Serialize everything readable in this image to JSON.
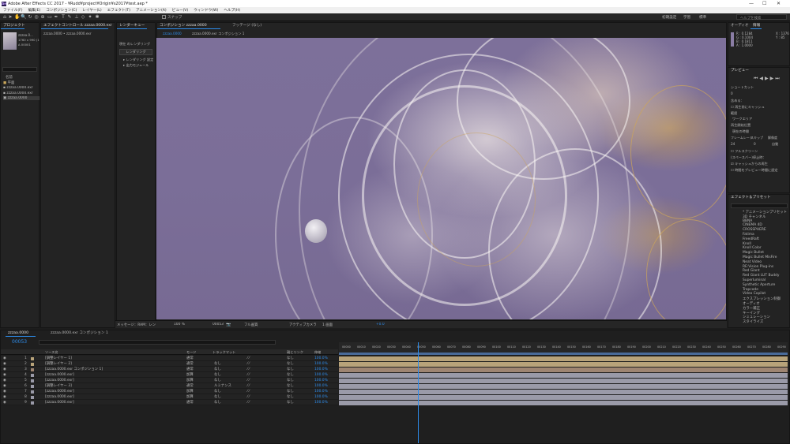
{
  "app": {
    "title": "Adobe After Effects CC 2017 - ¥Rudd¥project¥Origin¥s2017¥test.aep *",
    "menu": [
      "ファイル(F)",
      "編集(E)",
      "コンポジション(C)",
      "レイヤー(L)",
      "エフェクト(T)",
      "アニメーション(A)",
      "ビュー(V)",
      "ウィンドウ(W)",
      "ヘルプ(H)"
    ],
    "toolbar": {
      "snap_label": "スナップ",
      "workspace_default": "初期設定",
      "workspace_learn": "学習",
      "workspace_standard": "標準",
      "search_placeholder": "ヘルプを検索"
    }
  },
  "project": {
    "tab": "プロジェクト",
    "fx_tab": "エフェクトコントロール zzzaa.0000.exr",
    "thumb_name": "zzzaa.0...",
    "thumb_info": "1760 x 990 (1.00)",
    "thumb_info2": "Δ 00001",
    "col_name": "名前",
    "items": [
      "平面",
      "zzzaa.0000.exr",
      "zzzaa.0000.exr",
      "zzzaa.0000"
    ],
    "breadcrumb": "zzzaa.0000 • zzzaa.0000.exr"
  },
  "render_queue": {
    "tab": "レンダーキュー",
    "tb_label": "現在 のレンダリング",
    "render_btn": "レンダリング",
    "rows": [
      "レンダリング 設定",
      "出力モジュール"
    ]
  },
  "viewer": {
    "tabs": [
      "コンポジション zzzaa.0000",
      "フッテージ (なし)"
    ],
    "subtabs": [
      "zzzaa.0000",
      "zzzaa.0000.exr コンポジション 1"
    ],
    "bottom": {
      "message": "メッセージ：RAM：レン",
      "zoom": "100 %",
      "timecode": "00053",
      "quality": "フル画質",
      "camera": "アクティブカメラ",
      "views": "1 画面",
      "exposure": "+0.0"
    }
  },
  "info": {
    "tabs": [
      "オーディオ",
      "情報"
    ],
    "lines": [
      "R : 0.1284",
      "G : 0.1004",
      "B : 0.1811",
      "A : 1.0000"
    ],
    "xy": [
      "X : 1376",
      "Y : 85"
    ]
  },
  "preview": {
    "tab": "プレビュー",
    "shortcut_label": "ショートカット",
    "shortcut_value": "0",
    "include_label": "含める：",
    "cache_label": "再生前にキャッシュ",
    "range_label": "範囲",
    "range_value": "ワークエリア",
    "play_from_label": "再生開始位置",
    "play_from_value": "現在の時間",
    "frame_rate_label": "フレームレート",
    "frame_rate_value": "24",
    "skip_label": "スキップ",
    "skip_value": "0",
    "resolution_label": "解像度",
    "resolution_value": "自動",
    "fullscreen_label": "フルスクリーン",
    "stop_label": "(スペースバー)停止時：",
    "cache_opt": "キャッシュからの再生",
    "time_opt": "時間をプレビュー時間に設定"
  },
  "effects": {
    "tab": "エフェクト＆プリセット",
    "items": [
      "* アニメーションプリセット",
      "3D チャンネル",
      "BBNA",
      "CINEMA 4D",
      "CROSSPHERE",
      "Fatima",
      "FreedRaft",
      "Knoll",
      "Knoll Color",
      "Magic Bullet",
      "Magic Bullet MisFire",
      "Neat Video",
      "RE:Vision Plug-ins",
      "Red Giant",
      "Red Giant LUT Buddy",
      "Superluminal",
      "Synthetic Aperture",
      "Trapcode",
      "Video Copilot",
      "エクスプレッション制御",
      "オーディオ",
      "カラー補正",
      "キーイング",
      "シミュレーション",
      "スタイライズ"
    ]
  },
  "timeline": {
    "tab1": "zzzaa.0000",
    "tab2": "zzzaa.0000.exr コンポジション 1",
    "timecode": "00053",
    "col_headers": {
      "src": "ソース名",
      "mode": "モード",
      "trkmat": "トラックマット",
      "parent": "親とリンク",
      "stretch": "伸縮"
    },
    "layers": [
      {
        "n": "1",
        "name": "[調整レイヤー 1]",
        "mode": "通常",
        "trk": "",
        "parent": "なし",
        "stretch": "100.0%",
        "color": "#b8a37a"
      },
      {
        "n": "2",
        "name": "[調整レイヤー 2]",
        "mode": "通常",
        "trk": "なし",
        "parent": "なし",
        "stretch": "100.0%",
        "color": "#b8a37a"
      },
      {
        "n": "3",
        "name": "[zzzaa.0000.exr コンポジション 1]",
        "mode": "通常",
        "trk": "なし",
        "parent": "なし",
        "stretch": "100.0%",
        "color": "#9e8572"
      },
      {
        "n": "4",
        "name": "[zzzaa.0000.exr]",
        "mode": "加算",
        "trk": "なし",
        "parent": "なし",
        "stretch": "100.0%",
        "color": "#9a9aa8"
      },
      {
        "n": "5",
        "name": "[zzzaa.0000.exr]",
        "mode": "加算",
        "trk": "なし",
        "parent": "なし",
        "stretch": "100.0%",
        "color": "#9a9aa8"
      },
      {
        "n": "6",
        "name": "[調整レイヤー 3]",
        "mode": "通常",
        "trk": "ルミナンス",
        "parent": "なし",
        "stretch": "100.0%",
        "color": "#9a9aa8"
      },
      {
        "n": "7",
        "name": "[zzzaa.0000.exr]",
        "mode": "加算",
        "trk": "なし",
        "parent": "なし",
        "stretch": "100.0%",
        "color": "#9a9aa8"
      },
      {
        "n": "8",
        "name": "[zzzaa.0000.exr]",
        "mode": "加算",
        "trk": "なし",
        "parent": "なし",
        "stretch": "100.0%",
        "color": "#9a9aa8"
      },
      {
        "n": "9",
        "name": "[zzzaa.0000.exr]",
        "mode": "通常",
        "trk": "なし",
        "parent": "なし",
        "stretch": "100.0%",
        "color": "#9a9aa8"
      }
    ],
    "ruler": [
      "00000",
      "00010",
      "00020",
      "00030",
      "00040",
      "00050",
      "00060",
      "00070",
      "00080",
      "00090",
      "00100",
      "00110",
      "00120",
      "00130",
      "00140",
      "00150",
      "00160",
      "00170",
      "00180",
      "00190",
      "00200",
      "00210",
      "00220",
      "00230",
      "00240",
      "00250",
      "00260",
      "00270",
      "00280",
      "00290"
    ],
    "colors": {
      "accent": "#2d8ceb",
      "work": "#4a6b9a"
    }
  }
}
